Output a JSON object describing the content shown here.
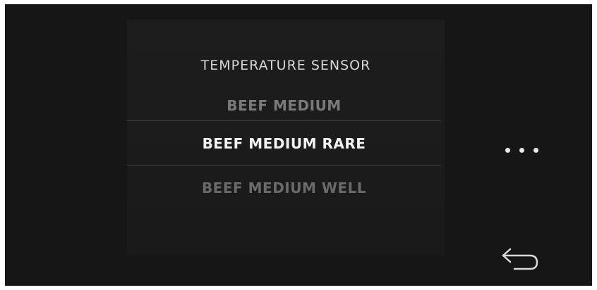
{
  "menu": {
    "title": "TEMPERATURE SENSOR",
    "items": [
      {
        "label": "BEEF MEDIUM"
      },
      {
        "label": "BEEF MEDIUM RARE"
      },
      {
        "label": "BEEF MEDIUM WELL"
      }
    ],
    "selected_index": 1
  },
  "controls": {
    "more_icon": "ellipsis-icon",
    "back_icon": "return-arrow-icon"
  },
  "colors": {
    "background": "#161616",
    "selected_text": "#f2f2f2",
    "dim_text": "#6f6f6f"
  }
}
